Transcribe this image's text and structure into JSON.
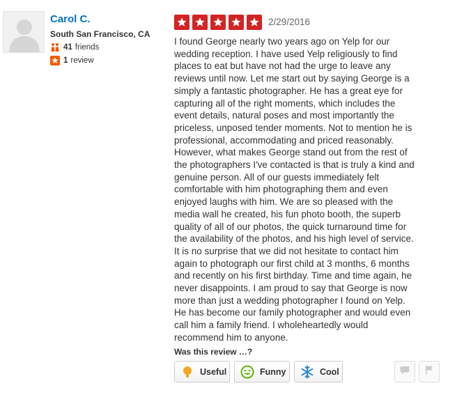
{
  "user": {
    "name": "Carol C.",
    "location": "South San Francisco, CA",
    "friends_count": "41",
    "friends_label": "friends",
    "reviews_count": "1",
    "reviews_label": "review"
  },
  "review": {
    "rating": 5,
    "date": "2/29/2016",
    "text": "I found George nearly two years ago on Yelp for our\nwedding reception.  I have used Yelp religiously to find\nplaces to eat but have not had the urge to leave any\nreviews until now.  Let me start out by saying George is a\nsimply a fantastic photographer.  He has a great eye for\ncapturing all of the right moments, which includes the\nevent details, natural poses and most importantly the\npriceless, unposed tender moments.  Not to mention he is\nprofessional, accommodating and priced reasonably.\n However, what makes George stand out from the rest of\nthe photographers I've contacted is that is truly a kind and\ngenuine person.  All of our guests immediately felt\ncomfortable with him photographing them and even\nenjoyed laughs with him.  We are so pleased with the\nmedia wall he created, his fun photo booth, the superb\nquality of all of our photos, the quick turnaround time for\nthe availability of the photos, and his high level of service.\n It is no surprise that we did not hesitate to contact him\nagain to photograph our first child at 3 months, 6 months\nand recently on his first birthday.  Time and time again, he\nnever disappoints.  I am proud to say that George is now\nmore than just a wedding photographer I found on Yelp.\nHe has become our family photographer and would even\ncall him a family friend.  I wholeheartedly would\nrecommend him to anyone."
  },
  "votes": {
    "title": "Was this review …?",
    "useful_label": "Useful",
    "funny_label": "Funny",
    "cool_label": "Cool"
  },
  "colors": {
    "star_red": "#d32323",
    "link_blue": "#0073bb",
    "useful_orange": "#f5a623",
    "funny_green": "#5fb709",
    "cool_blue": "#2a8bd4"
  },
  "icons": {
    "avatar": "default-user-avatar",
    "friends": "friends-icon",
    "reviews": "review-star-icon",
    "useful": "lightbulb-icon",
    "funny": "smiley-icon",
    "cool": "snowflake-icon",
    "comment": "comment-icon",
    "flag": "flag-icon"
  }
}
